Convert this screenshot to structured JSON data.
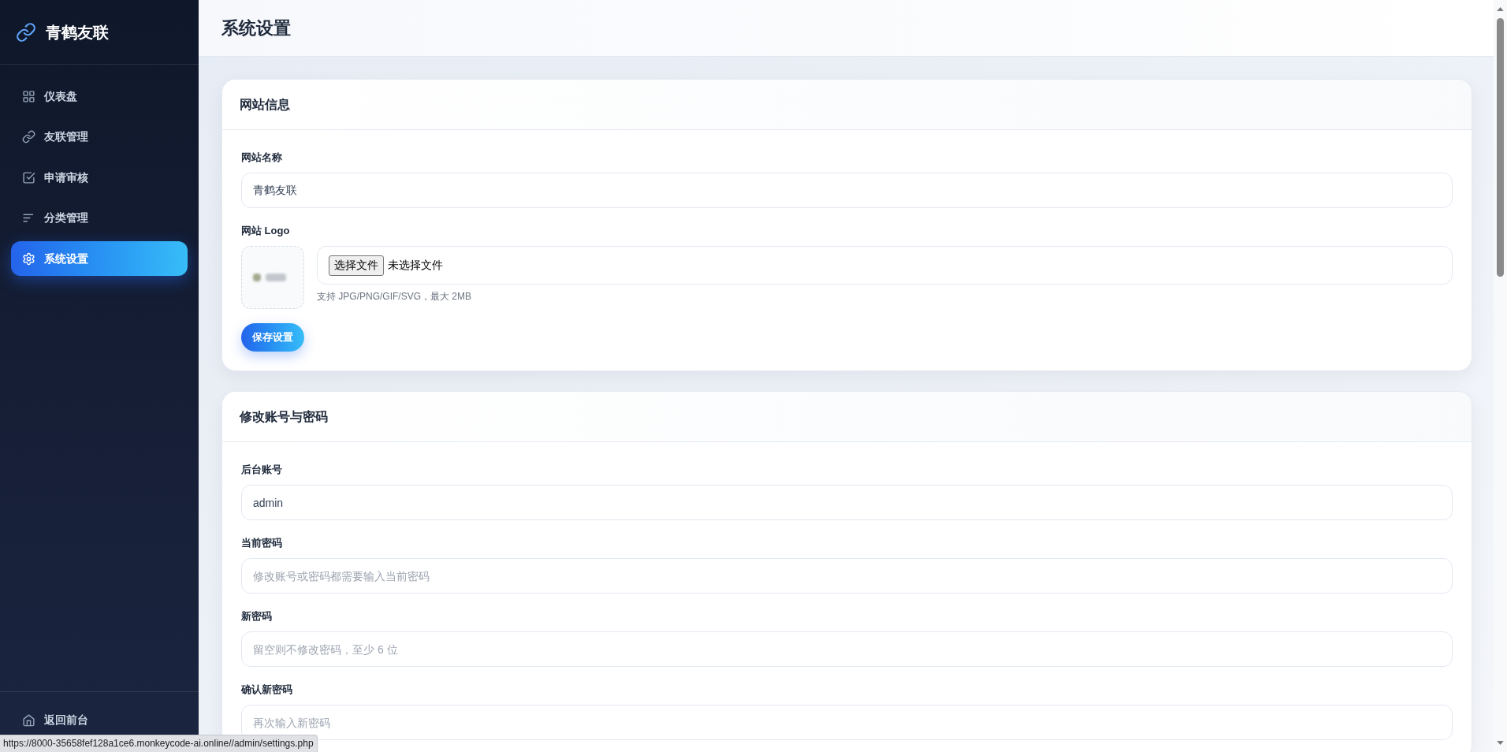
{
  "sidebar": {
    "brand": "青鹤友联",
    "nav_items": [
      {
        "label": "仪表盘",
        "selected": false
      },
      {
        "label": "友联管理",
        "selected": false
      },
      {
        "label": "申请审核",
        "selected": false
      },
      {
        "label": "分类管理",
        "selected": false
      },
      {
        "label": "系统设置",
        "selected": true
      }
    ],
    "footer_link": "返回前台"
  },
  "header": {
    "title": "系统设置"
  },
  "cards": [
    {
      "title": "网站信息",
      "fields": [
        {
          "kind": "text",
          "label": "网站名称",
          "value": "青鹤友联"
        },
        {
          "kind": "file",
          "label": "网站 Logo",
          "button": "选择文件",
          "file_status": "未选择文件",
          "hint": "支持 JPG/PNG/GIF/SVG，最大 2MB"
        }
      ],
      "button": "保存设置"
    },
    {
      "title": "修改账号与密码",
      "fields": [
        {
          "kind": "text",
          "label": "后台账号",
          "value": "admin"
        },
        {
          "kind": "password",
          "label": "当前密码",
          "placeholder": "修改账号或密码都需要输入当前密码"
        },
        {
          "kind": "password",
          "label": "新密码",
          "placeholder": "留空则不修改密码，至少 6 位"
        },
        {
          "kind": "password",
          "label": "确认新密码",
          "placeholder": "再次输入新密码"
        }
      ]
    }
  ],
  "status_bar": {
    "url": "https://8000-35658fef128a1ce6.monkeycode-ai.online//admin/settings.php"
  }
}
